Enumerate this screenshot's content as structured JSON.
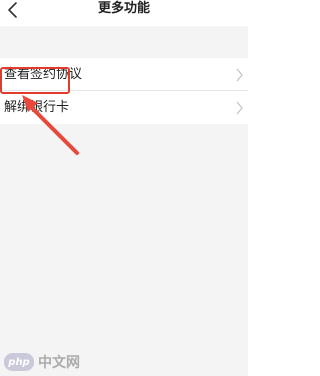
{
  "header": {
    "title": "更多功能",
    "back_icon": "chevron-left-icon"
  },
  "menu": {
    "items": [
      {
        "label": "查看签约协议",
        "icon": "chevron-right-icon"
      },
      {
        "label": "解绑银行卡",
        "icon": "chevron-right-icon"
      }
    ]
  },
  "annotation": {
    "highlight_color": "#e23b2e"
  },
  "watermark": {
    "logo_text": "php",
    "text": "中文网"
  }
}
